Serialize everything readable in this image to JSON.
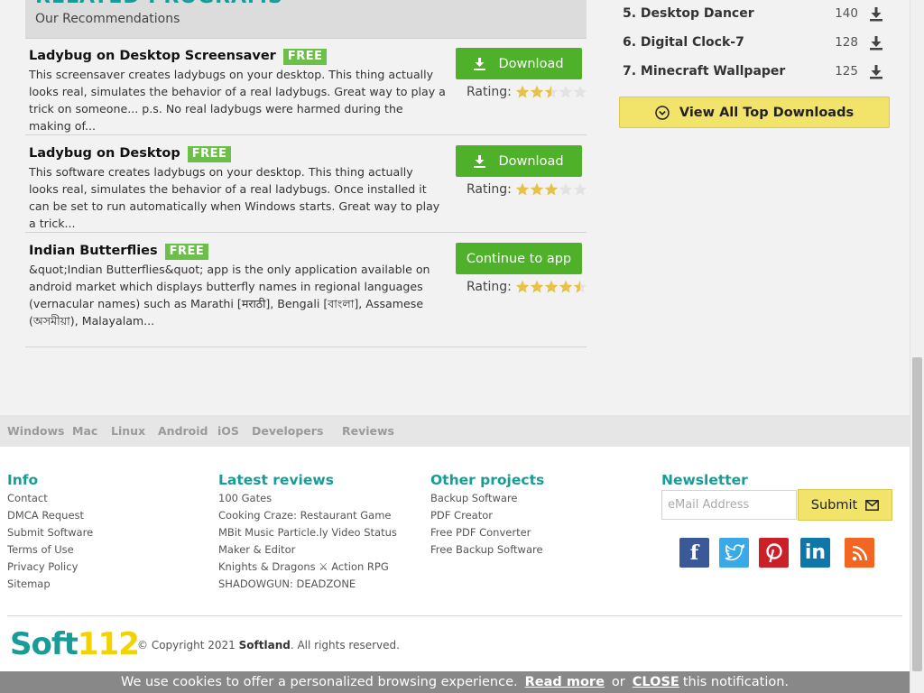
{
  "related": {
    "title": "RELATED PROGRAMS",
    "subtitle": "Our Recommendations",
    "programs": [
      {
        "name": "Ladybug on Desktop Screensaver",
        "badge": "FREE",
        "description": "This screensaver creates ladybugs on your desktop. This thing actually looks real, simulates the behavior of a real ladybugs. Great way to play a trick on someone... p.s. No real ladybugs were harmed during the making of...",
        "button": "Download",
        "rating_label": "Rating:",
        "rating": 2.5
      },
      {
        "name": "Ladybug on Desktop",
        "badge": "FREE",
        "description": "This software creates ladybugs on your desktop. This thing actually looks real, simulates the behavior of a real ladybugs. Once installed it can be set to run automatically when Windows starts. Great way to play a trick...",
        "button": "Download",
        "rating_label": "Rating:",
        "rating": 3
      },
      {
        "name": "Indian Butterflies",
        "badge": "FREE",
        "description": "&quot;Indian Butterflies&quot; app is the only application available on android market which displays butterfly names in regional languages (vernacular names) such as Marathi [मराठी], Bengali [বাংলা], Assamese (অসমীয়া), Malayalam...",
        "button": "Continue to app",
        "rating_label": "Rating:",
        "rating": 4.5
      }
    ]
  },
  "top_downloads": {
    "items": [
      {
        "label": "5. Desktop Dancer",
        "count": "140"
      },
      {
        "label": "6. Digital Clock-7",
        "count": "128"
      },
      {
        "label": "7. Minecraft Wallpaper",
        "count": "125"
      }
    ],
    "view_all": "View All Top Downloads"
  },
  "nav": [
    "Windows",
    "Mac",
    "Linux",
    "Android",
    "iOS",
    "Developers",
    "Reviews"
  ],
  "footer": {
    "info": {
      "title": "Info",
      "links": [
        "Contact",
        "DMCA Request",
        "Submit Software",
        "Terms of Use",
        "Privacy Policy",
        "Sitemap"
      ]
    },
    "reviews": {
      "title": "Latest reviews",
      "links": [
        "100 Gates",
        "Cooking Craze: Restaurant Game",
        "MBit Music Particle.ly Video Status Maker & Editor",
        "Knights & Dragons ⚔ Action RPG",
        "SHADOWGUN: DEADZONE"
      ]
    },
    "projects": {
      "title": "Other projects",
      "links": [
        "Backup Software",
        "PDF Creator",
        "Free PDF Converter",
        "Free Backup Software"
      ]
    },
    "newsletter": {
      "title": "Newsletter",
      "placeholder": "eMail Address",
      "submit": "Submit"
    },
    "social": {
      "facebook": "f",
      "linkedin": "in"
    },
    "logo": {
      "part1": "Soft",
      "part2": "112"
    },
    "copyright": {
      "prefix": "© Copyright 2021",
      "brand": "Softland",
      "suffix": ". All rights reserved."
    }
  },
  "cookie": {
    "text": "We use cookies to offer a personalized browsing experience.",
    "read_more": "Read more",
    "or": "or",
    "close": "CLOSE",
    "tail": "this notification."
  },
  "colors": {
    "teal": "#1a9c96",
    "green": "#4fb02a",
    "yellow": "#f2e36a",
    "star": "#e5c24a"
  }
}
